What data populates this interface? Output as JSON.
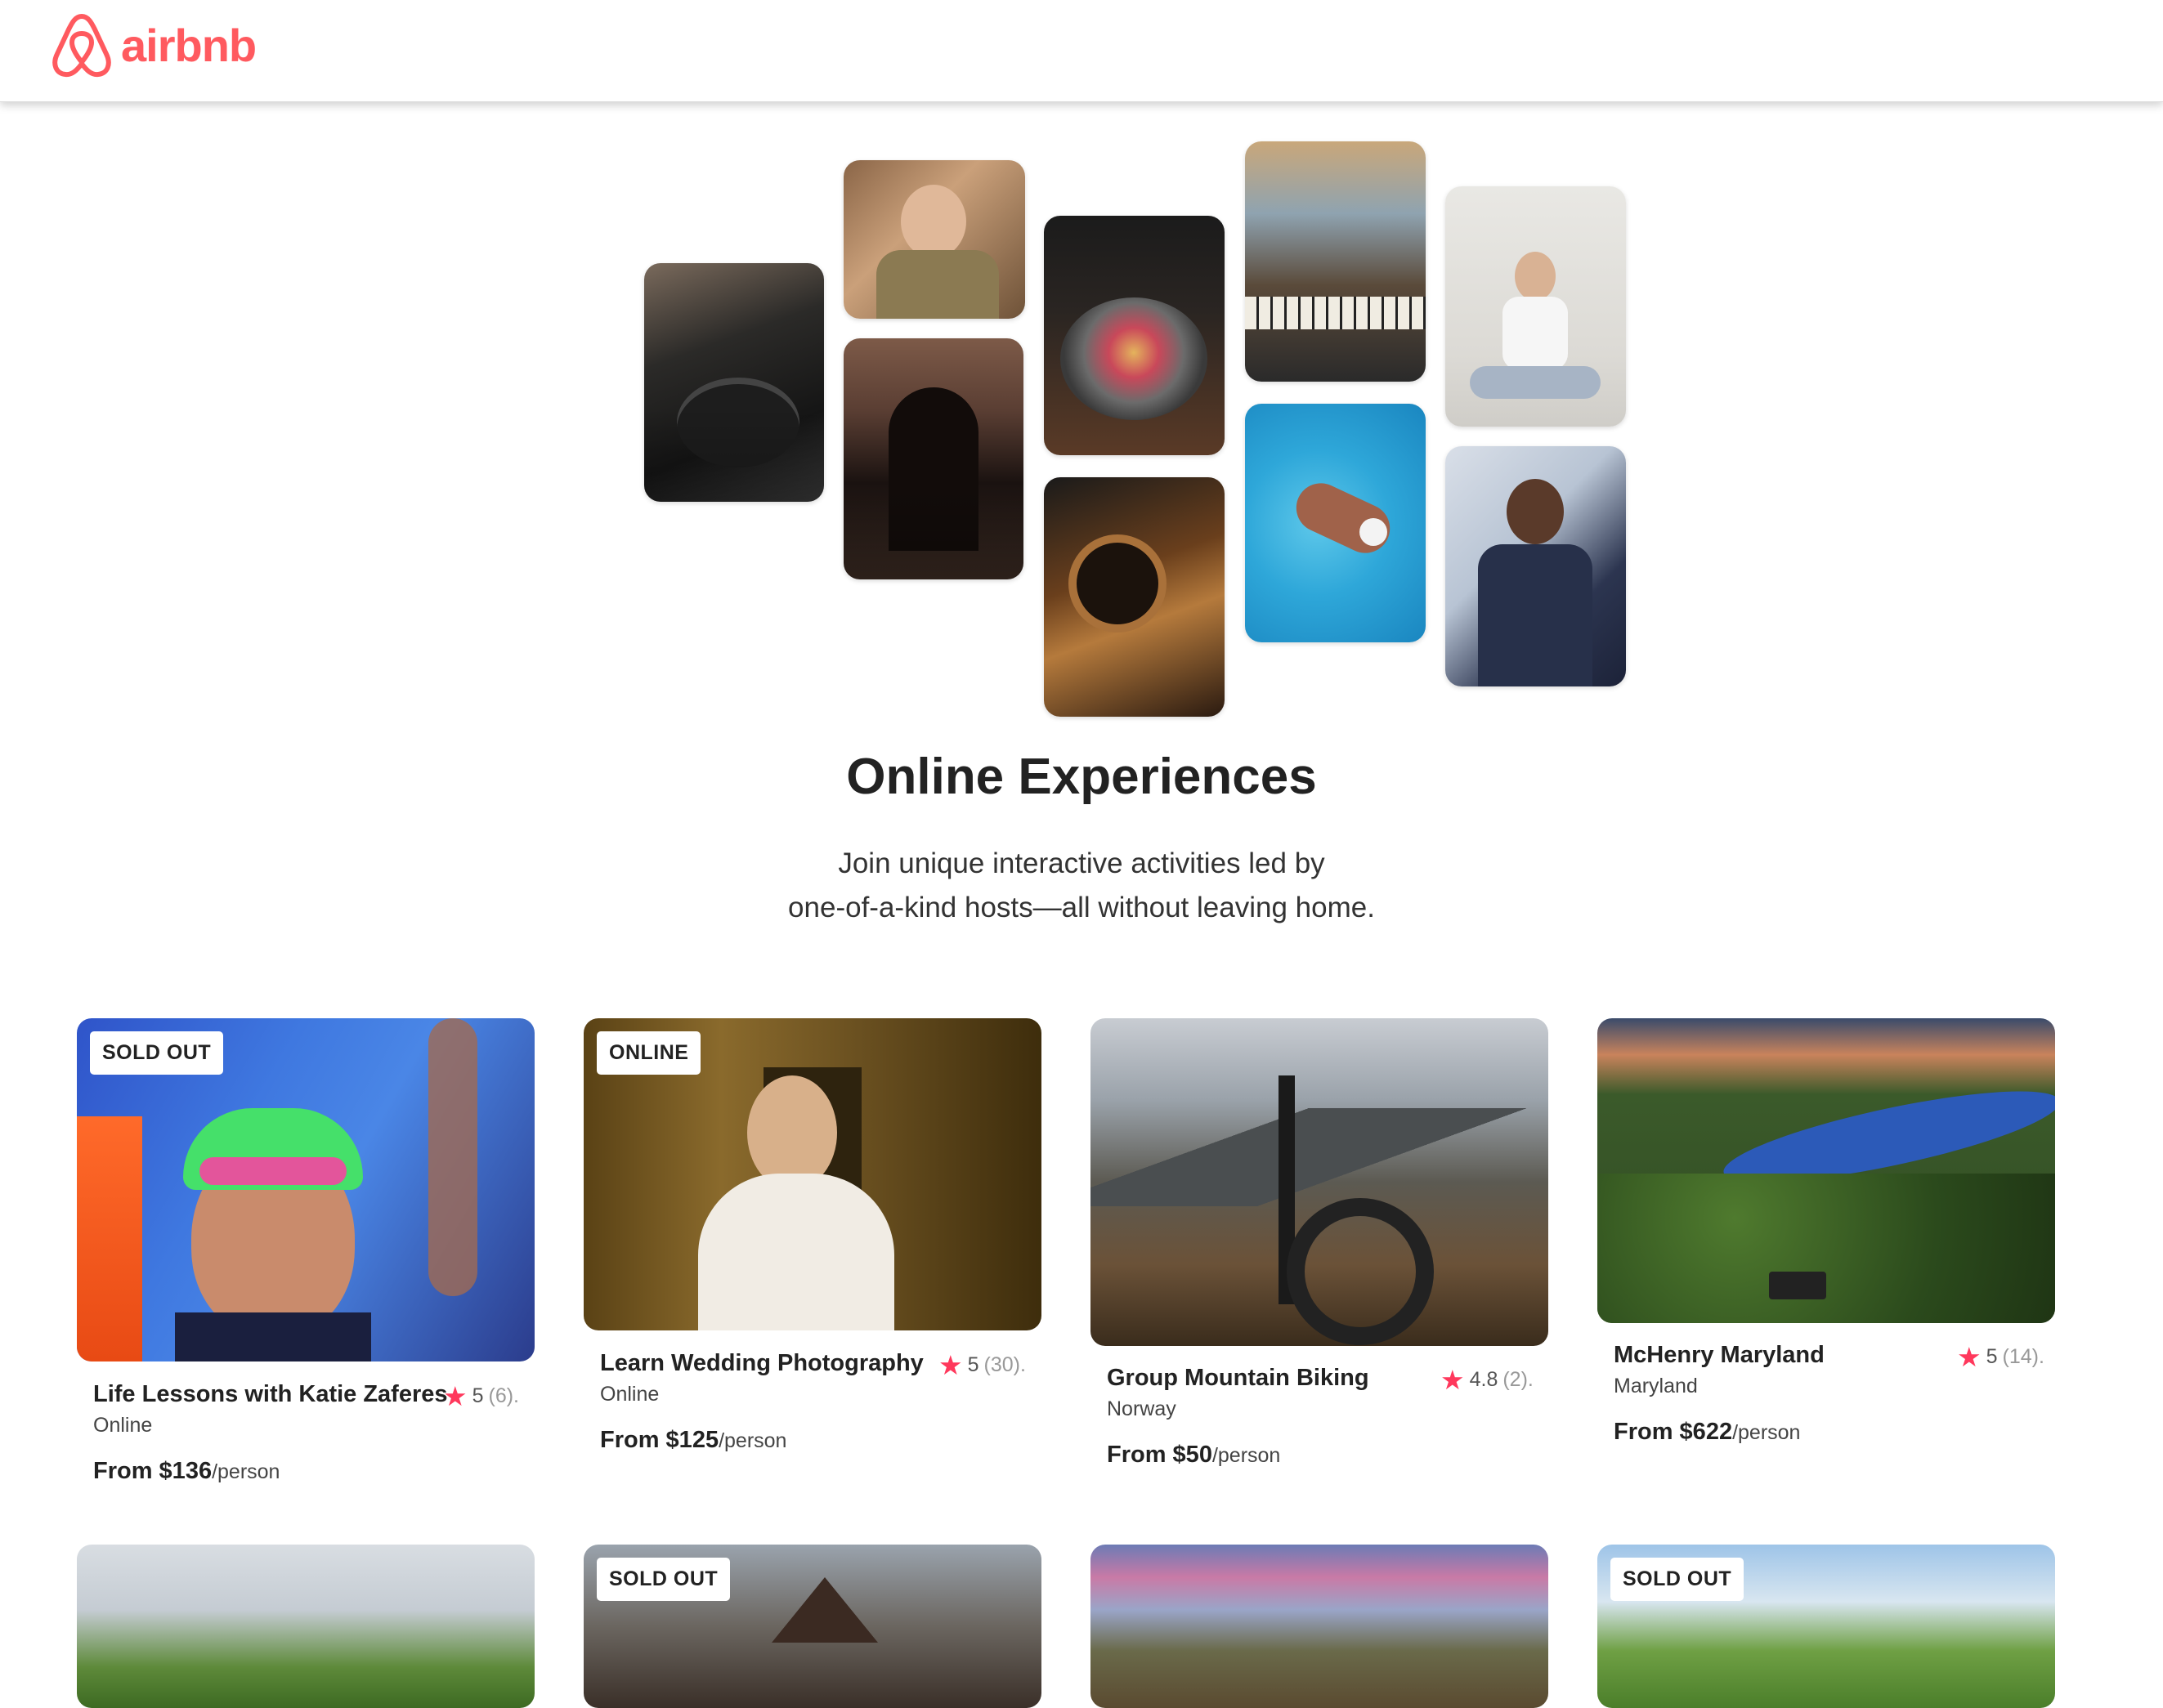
{
  "header": {
    "brand": "airbnb",
    "brand_color": "#ff5a5f"
  },
  "hero": {
    "title": "Online Experiences",
    "subtitle_line1": "Join unique interactive activities led by",
    "subtitle_line2": "one-of-a-kind hosts—all without leaving home."
  },
  "accent_color": "#ff385c",
  "cards": [
    {
      "badge": "SOLD OUT",
      "title": "Life Lessons with Katie Zaferes",
      "rating": "5",
      "reviews": "(6).",
      "location": "Online",
      "price": "From $136",
      "per": "/person"
    },
    {
      "badge": "ONLINE",
      "title": "Learn Wedding Photography",
      "rating": "5",
      "reviews": "(30).",
      "location": "Online",
      "price": "From $125",
      "per": "/person"
    },
    {
      "badge": "",
      "title": "Group Mountain Biking",
      "rating": "4.8",
      "reviews": "(2).",
      "location": "Norway",
      "price": "From $50",
      "per": "/person"
    },
    {
      "badge": "",
      "title": "McHenry Maryland",
      "rating": "5",
      "reviews": "(14).",
      "location": "Maryland",
      "price": "From $622",
      "per": "/person"
    }
  ],
  "row2_badges": [
    "",
    "SOLD OUT",
    "",
    "SOLD OUT"
  ]
}
